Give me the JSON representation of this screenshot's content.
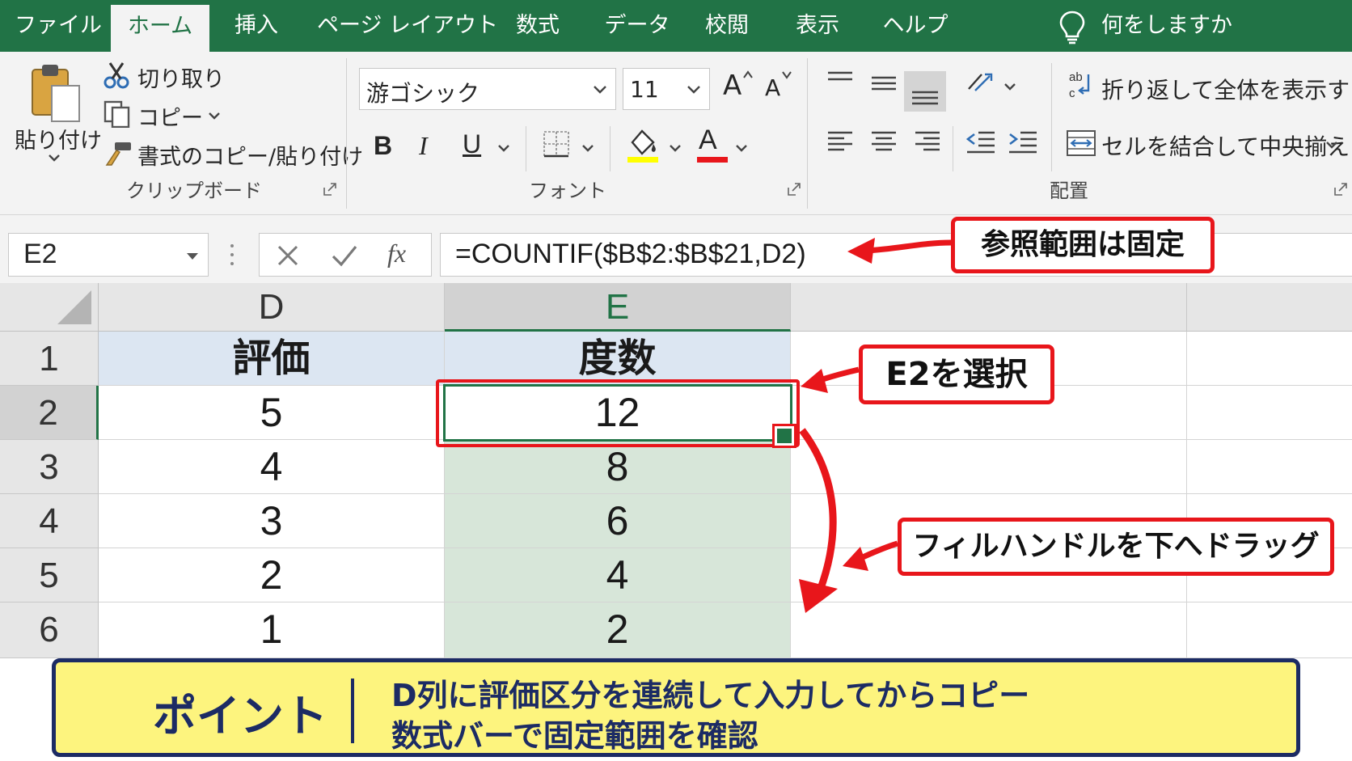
{
  "tabs": [
    "ファイル",
    "ホーム",
    "挿入",
    "ページ レイアウト",
    "数式",
    "データ",
    "校閲",
    "表示",
    "ヘルプ"
  ],
  "tell_me": "何をしますか",
  "clipboard": {
    "paste": "貼り付け",
    "cut": "切り取り",
    "copy": "コピー",
    "format_painter": "書式のコピー/貼り付け",
    "group_label": "クリップボード"
  },
  "font": {
    "name": "游ゴシック",
    "size": "11",
    "bold": "B",
    "italic": "I",
    "underline": "U",
    "grow": "A",
    "shrink": "A",
    "font_color": "A",
    "group_label": "フォント",
    "highlight_color": "#ffff00",
    "text_color": "#e8161b"
  },
  "alignment": {
    "wrap": "折り返して全体を表示する",
    "merge": "セルを結合して中央揃え",
    "group_label": "配置"
  },
  "formula_bar": {
    "name_box": "E2",
    "formula": "=COUNTIF($B$2:$B$21,D2)",
    "fx": "fx"
  },
  "sheet": {
    "columns": [
      "D",
      "E"
    ],
    "rows": [
      "1",
      "2",
      "3",
      "4",
      "5",
      "6"
    ],
    "header": [
      "評価",
      "度数"
    ],
    "d_values": [
      "5",
      "4",
      "3",
      "2",
      "1"
    ],
    "e_values": [
      "12",
      "8",
      "6",
      "4",
      "2"
    ]
  },
  "callouts": {
    "fixed_range": "参照範囲は固定",
    "select_e2": "E2を選択",
    "fill_handle": "フィルハンドルを下へドラッグ"
  },
  "point": {
    "title": "ポイント",
    "line1": "D列に評価区分を連続して入力してからコピー",
    "line2": "数式バーで固定範囲を確認"
  },
  "colors": {
    "excel_green": "#217346",
    "callout_red": "#e8161b",
    "point_bg": "#fdf47e",
    "point_navy": "#1c2b64"
  }
}
